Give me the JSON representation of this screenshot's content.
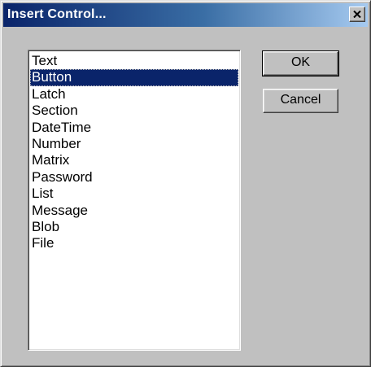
{
  "window": {
    "title": "Insert Control..."
  },
  "titlebar": {
    "close_icon": "close-x-icon"
  },
  "listbox": {
    "items": [
      "Text",
      "Button",
      "Latch",
      "Section",
      "DateTime",
      "Number",
      "Matrix",
      "Password",
      "List",
      "Message",
      "Blob",
      "File"
    ],
    "selected": "Button"
  },
  "buttons": {
    "ok_label": "OK",
    "cancel_label": "Cancel"
  },
  "colors": {
    "titlebar_start": "#0a246a",
    "titlebar_end": "#a6caf0",
    "dialog_face": "#c0c0c0",
    "selection": "#0a246a"
  }
}
